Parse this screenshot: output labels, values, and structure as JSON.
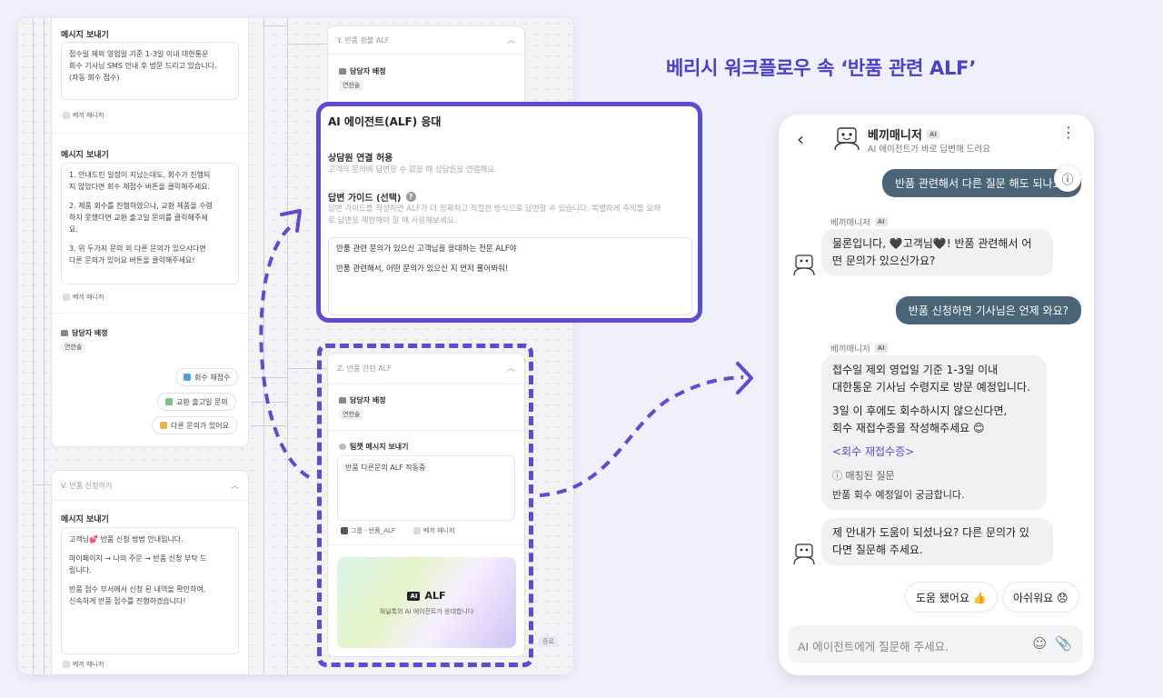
{
  "heading": "베리시 워크플로우 속 ‘반품 관련 ALF’",
  "col1": {
    "send_msg": "메시지 보내기",
    "msg1_lines": [
      "접수일 제외 영업일 기준 1-3일 이내 대한통운",
      "회수 기사님 SMS 안내 후 방문 드리고 있습니다.",
      "(자동 회수 접수)"
    ],
    "msg2_lines": [
      "1. 안내드린 일정이 지났는데도, 회수가 진행되",
      "지 않았다면 회수 재접수 버튼을 클릭해주세요.",
      "",
      "2. 제품 회수를 진행하였으나, 교환 제품을 수령",
      "하지 못했다면 교환 출고일 문의를 클릭해주세",
      "요.",
      "",
      "3. 위 두가지 문의 외 다른 문의가 있으시다면",
      "다른 문의가 있어요 버튼을 클릭해주세요!"
    ],
    "manager_tag": "베끼 매니저",
    "assign_title": "담당자 배정",
    "assignee": "연한솔",
    "buttons": [
      "회수 재접수",
      "교환 출고일 문의",
      "다른 문의가 있어요"
    ],
    "v_title": "V. 반품 신청하기",
    "msg3_lines": [
      "고객님💕 반품 신청 방법 안내입니다.",
      "",
      "마이페이지 → 나의 주문 → 반품 신청 부탁 드",
      "립니다.",
      "",
      "반품 접수 부서에서 신청 된 내역을 확인하여,",
      "신속하게 반품 접수를 진행하겠습니다!"
    ]
  },
  "col2": {
    "y_title": "Y. 반품 환불 ALF",
    "assign_title": "담당자 배정",
    "assignee": "연한솔",
    "z_title": "Z. 반품 관련 ALF",
    "team_chat_title": "팀챗 메시지 보내기",
    "team_chat_msg": "반품 다른문의 ALF 작동중",
    "group_tag": "그룹 - 반품_ALF",
    "manager_tag": "베끼 매니저",
    "alf_label": "ALF",
    "alf_sub": "채널톡의 AI 에이전트가 응대합니다",
    "end_label": "종료"
  },
  "callout": {
    "title": "AI 에이전트(ALF) 응대",
    "connect_title": "상담원 연결 허용",
    "connect_desc": "고객의 문의에 답변할 수 없을 때 상담원을 연결해요.",
    "guide_title": "답변 가이드 (선택)",
    "guide_desc_lines": [
      "답변 가이드를 작성하면 ALF가 더 정확하고 적절한 방식으로 답변할 수 있습니다. 특별하게 주의를 요하",
      "로 답변을 제한해야 할 때 사용해보세요."
    ],
    "guide_text_lines": [
      "반품 관련 문의가 있으신 고객님을 응대하는 전문 ALF야",
      "",
      "반품 관련해서, 어떤 문의가 있으신 지 먼저 물어봐줘!"
    ]
  },
  "phone": {
    "bot_name": "베끼매니저",
    "ai_badge": "AI",
    "bot_sub": "AI 에이전트가 바로 답변해 드려요",
    "u1": "반품 관련해서 다른 질문 해도 되나요?",
    "b1_lines": [
      "물론입니다, 🖤고객님🖤! 반품 관련해서 어",
      "떤 문의가 있으신가요?"
    ],
    "u2": "반품 신청하면 기사님은 언제 와요?",
    "b2_lines": [
      "접수일 제외 영업일 기준 1-3일 이내",
      "대한통운 기사님 수령지로 방문 예정입니다."
    ],
    "b2_lines2": [
      "3일 이 후에도 회수하시지 않으신다면,",
      "회수 재접수증을 작성해주세요 😊"
    ],
    "b2_link": "<회수 재접수증>",
    "b2_matched": "매칭된 질문",
    "b2_question": "반품 회수 예정일이 궁금합니다.",
    "b3_lines": [
      "제 안내가 도움이 되셨나요? 다른 문의가 있",
      "다면 질문해 주세요."
    ],
    "fb_yes": "도움 됐어요 👍",
    "fb_no": "아쉬워요 😞",
    "input_placeholder": "AI 에이전트에게 질문해 주세요."
  },
  "colors": {
    "accent": "#5b4bd6",
    "user_bubble": "#4a6578"
  }
}
